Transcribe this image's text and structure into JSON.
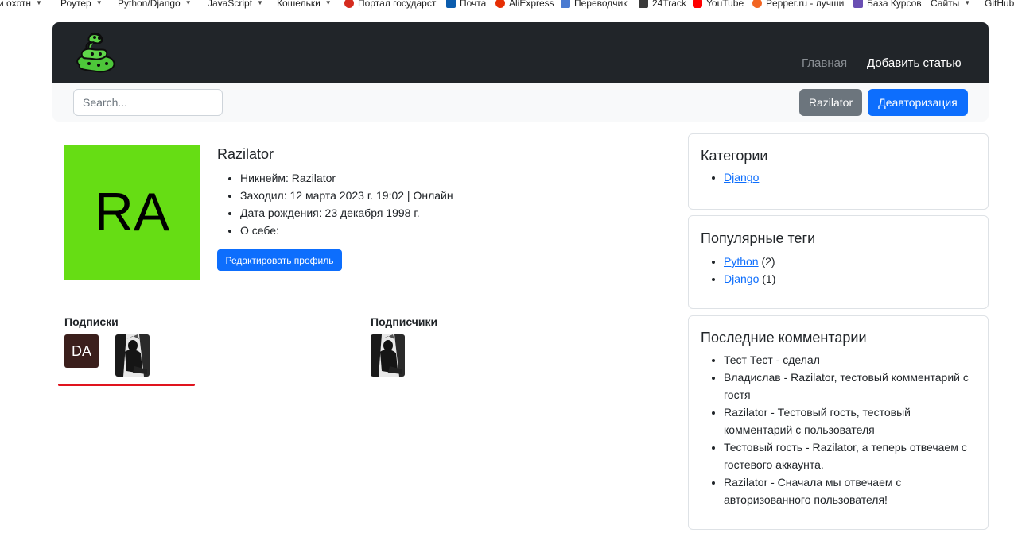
{
  "bookmarks": [
    {
      "label": "и охотн",
      "dropdown": true,
      "icon": ""
    },
    {
      "label": "Роутер",
      "dropdown": true,
      "icon": ""
    },
    {
      "label": "Python/Django",
      "dropdown": true,
      "icon": ""
    },
    {
      "label": "JavaScript",
      "dropdown": true,
      "icon": ""
    },
    {
      "label": "Кошельки",
      "dropdown": true,
      "icon": ""
    },
    {
      "label": "Портал государст",
      "dropdown": false,
      "icon": "flag-icon",
      "color": "#d52b1e"
    },
    {
      "label": "Почта",
      "dropdown": false,
      "icon": "mail-icon",
      "color": "#0b5cad"
    },
    {
      "label": "AliExpress",
      "dropdown": false,
      "icon": "aliexpress-icon",
      "color": "#e62e04"
    },
    {
      "label": "Переводчик",
      "dropdown": false,
      "icon": "translate-icon",
      "color": "#4a7bd1"
    },
    {
      "label": "24Track",
      "dropdown": false,
      "icon": "track-icon",
      "color": "#3a3a3a"
    },
    {
      "label": "YouTube",
      "dropdown": false,
      "icon": "youtube-icon",
      "color": "#ff0000"
    },
    {
      "label": "Pepper.ru - лучши",
      "dropdown": false,
      "icon": "pepper-icon",
      "color": "#f26522"
    },
    {
      "label": "База Курсов",
      "dropdown": false,
      "icon": "course-icon",
      "color": "#6a4fb3"
    },
    {
      "label": "Сайты",
      "dropdown": true,
      "icon": ""
    },
    {
      "label": "GitHub",
      "dropdown": false,
      "icon": ""
    }
  ],
  "navbar": {
    "logo_icon": "snake-logo-icon",
    "home": "Главная",
    "add_article": "Добавить статью"
  },
  "subbar": {
    "search_placeholder": "Search...",
    "user_button": "Razilator",
    "logout_button": "Деавторизация"
  },
  "profile": {
    "avatar_initials": "RA",
    "avatar_color": "#66dd14",
    "name": "Razilator",
    "details": [
      "Никнейм: Razilator",
      "Заходил: 12 марта 2023 г. 19:02 | Онлайн",
      "Дата рождения: 23 декабря 1998 г.",
      "О себе:"
    ],
    "edit_button": "Редактировать профиль"
  },
  "subscriptions": {
    "title": "Подписки",
    "items": [
      {
        "type": "initials",
        "text": "DA",
        "color": "#3b1f1c"
      },
      {
        "type": "photo",
        "icon": "user-photo-icon"
      }
    ]
  },
  "subscribers": {
    "title": "Подписчики",
    "items": [
      {
        "type": "photo",
        "icon": "user-photo-icon"
      }
    ]
  },
  "sidebar": {
    "categories": {
      "title": "Категории",
      "items": [
        {
          "label": "Django"
        }
      ]
    },
    "tags": {
      "title": "Популярные теги",
      "items": [
        {
          "label": "Python",
          "count": "(2)"
        },
        {
          "label": "Django",
          "count": "(1)"
        }
      ]
    },
    "comments": {
      "title": "Последние комментарии",
      "items": [
        "Тест Тест - сделал",
        "Владислав - Razilator, тестовый комментарий с гостя",
        "Razilator - Тестовый гость, тестовый комментарий с пользователя",
        "Тестовый гость - Razilator, а теперь отвечаем с гостевого аккаунта.",
        "Razilator - Сначала мы отвечаем с авторизованного пользователя!"
      ]
    }
  },
  "colors": {
    "navbar_bg": "#212529",
    "primary": "#0d6efd",
    "secondary": "#6c757d",
    "accent_line": "#e0141e"
  }
}
